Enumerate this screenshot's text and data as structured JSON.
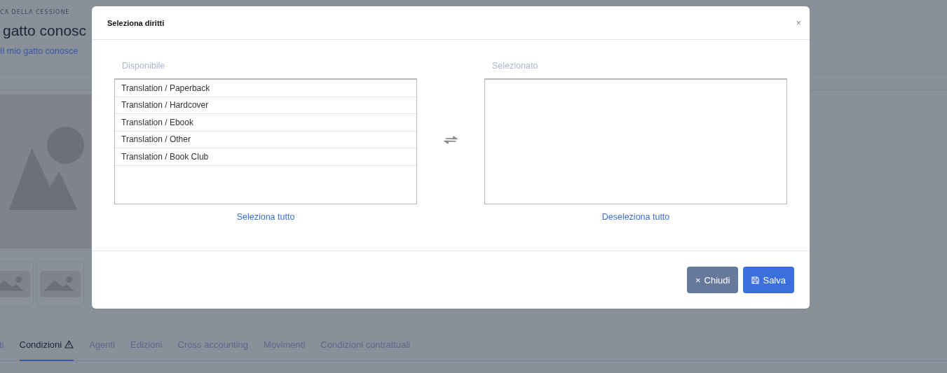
{
  "page": {
    "eyebrow": "CA DELLA CESSIONE",
    "title": "gatto conosc",
    "subtitle": "Il mio gatto conosce",
    "tabs": [
      {
        "label": "ti",
        "selected": false,
        "warning": false
      },
      {
        "label": "Condizioni",
        "selected": true,
        "warning": true
      },
      {
        "label": "Agenti",
        "selected": false,
        "warning": false
      },
      {
        "label": "Edizioni",
        "selected": false,
        "warning": false
      },
      {
        "label": "Cross accounting",
        "selected": false,
        "warning": false
      },
      {
        "label": "Movimenti",
        "selected": false,
        "warning": false
      },
      {
        "label": "Condizioni contrattuali",
        "selected": false,
        "warning": false
      }
    ]
  },
  "dialog": {
    "title": "Seleziona diritti",
    "close": "×",
    "available": {
      "label": "Disponibile",
      "items": [
        "Translation / Paperback",
        "Translation / Hardcover",
        "Translation / Ebook",
        "Translation / Other",
        "Translation / Book Club"
      ],
      "action": "Seleziona tutto"
    },
    "selected": {
      "label": "Selezionato",
      "action": "Deseleziona tutto"
    },
    "buttons": [
      {
        "kind": "secondary",
        "label": "Chiudi",
        "icon": "×"
      },
      {
        "kind": "primary",
        "label": "Salva"
      }
    ]
  }
}
